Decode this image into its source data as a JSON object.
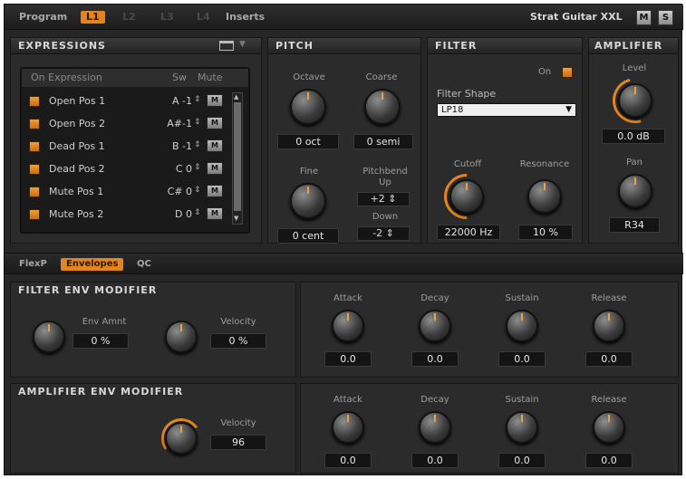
{
  "topbar": {
    "program_label": "Program",
    "tabs": [
      "L1",
      "L2",
      "L3",
      "L4"
    ],
    "inserts_label": "Inserts",
    "preset_name": "Strat Guitar XXL",
    "keyboard_btn": "M",
    "solo_btn": "S"
  },
  "expressions": {
    "title": "EXPRESSIONS",
    "headers": {
      "on_expression": "On Expression",
      "sw": "Sw",
      "mute": "Mute"
    },
    "rows": [
      {
        "name": "Open Pos 1",
        "sw": "A -1"
      },
      {
        "name": "Open Pos 2",
        "sw": "A#-1"
      },
      {
        "name": "Dead Pos 1",
        "sw": "B -1"
      },
      {
        "name": "Dead Pos 2",
        "sw": "C 0"
      },
      {
        "name": "Mute Pos 1",
        "sw": "C# 0"
      },
      {
        "name": "Mute Pos 2",
        "sw": "D 0"
      }
    ]
  },
  "pitch": {
    "title": "PITCH",
    "octave_label": "Octave",
    "octave_value": "0 oct",
    "coarse_label": "Coarse",
    "coarse_value": "0 semi",
    "fine_label": "Fine",
    "fine_value": "0 cent",
    "pitchbend_label": "Pitchbend",
    "up_label": "Up",
    "up_value": "+2",
    "down_label": "Down",
    "down_value": "-2"
  },
  "filter": {
    "title": "FILTER",
    "on_label": "On",
    "shape_label": "Filter Shape",
    "shape_value": "LP18",
    "cutoff_label": "Cutoff",
    "cutoff_value": "22000 Hz",
    "resonance_label": "Resonance",
    "resonance_value": "10 %"
  },
  "amplifier": {
    "title": "AMPLIFIER",
    "level_label": "Level",
    "level_value": "0.0 dB",
    "pan_label": "Pan",
    "pan_value": "R34"
  },
  "subtabs": [
    "FlexP",
    "Envelopes",
    "QC"
  ],
  "filter_env": {
    "title": "FILTER  ENV  MODIFIER",
    "env_amnt_label": "Env Amnt",
    "env_amnt_value": "0 %",
    "velocity_label": "Velocity",
    "velocity_value": "0 %",
    "adsr": {
      "attack": "0.0",
      "decay": "0.0",
      "sustain": "0.0",
      "release": "0.0"
    }
  },
  "amp_env": {
    "title": "AMPLIFIER  ENV  MODIFIER",
    "velocity_label": "Velocity",
    "velocity_value": "96",
    "adsr": {
      "attack": "0.0",
      "decay": "0.0",
      "sustain": "0.0",
      "release": "0.0"
    }
  },
  "adsr_labels": {
    "attack": "Attack",
    "decay": "Decay",
    "sustain": "Sustain",
    "release": "Release"
  },
  "mute_glyph": "M",
  "spin_glyph": "⇕"
}
